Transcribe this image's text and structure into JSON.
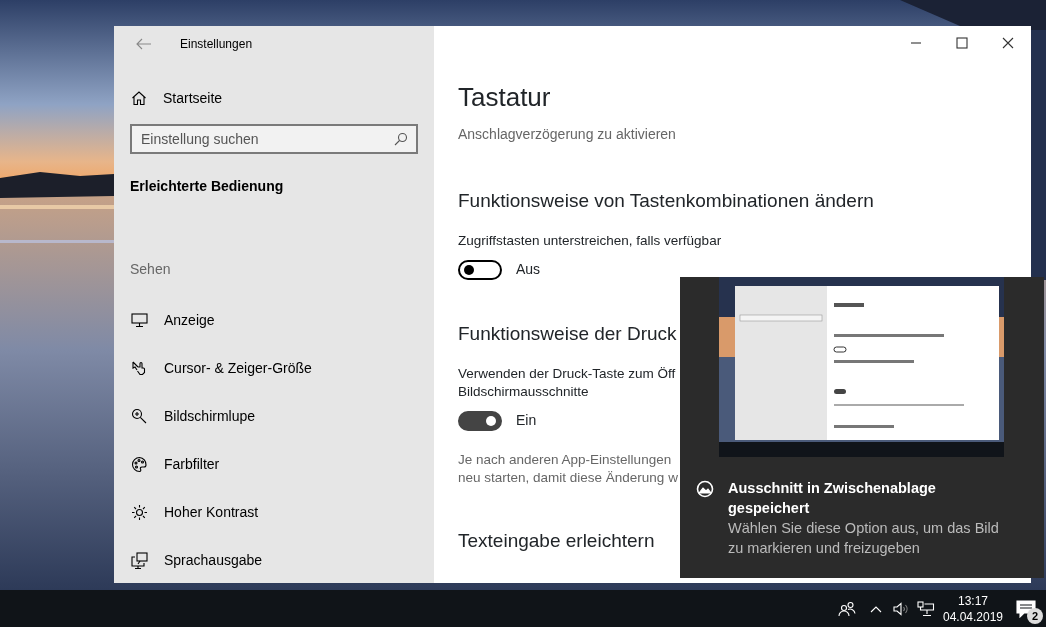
{
  "window": {
    "title": "Einstellungen"
  },
  "sidebar": {
    "home": "Startseite",
    "search": {
      "placeholder": "Einstellung suchen"
    },
    "category": "Erleichterte Bedienung",
    "section": "Sehen",
    "items": [
      {
        "label": "Anzeige"
      },
      {
        "label": "Cursor- & Zeiger-Größe"
      },
      {
        "label": "Bildschirmlupe"
      },
      {
        "label": "Farbfilter"
      },
      {
        "label": "Hoher Kontrast"
      },
      {
        "label": "Sprachausgabe"
      }
    ]
  },
  "main": {
    "title": "Tastatur",
    "partial_text": "Anschlagverzögerung zu aktivieren",
    "sections": [
      {
        "heading": "Funktionsweise von Tastenkombinationen ändern",
        "settings": [
          {
            "label": "Zugriffstasten unterstreichen, falls verfügbar",
            "on": false,
            "state_text": "Aus"
          }
        ]
      },
      {
        "heading": "Funktionsweise der Druck",
        "settings": [
          {
            "label": "Verwenden der Druck-Taste zum Öff",
            "label_line_2": "Bildschirmausschnitte",
            "on": true,
            "state_text": "Ein"
          }
        ],
        "note": "Je nach anderen App-Einstellungen",
        "note_line_2": "neu starten, damit diese Änderung w"
      },
      {
        "heading": "Texteingabe erleichtern"
      }
    ]
  },
  "notification": {
    "title": "Ausschnitt in Zwischenablage gespeichert",
    "body": "Wählen Sie diese Option aus, um das Bild zu markieren und freizugeben"
  },
  "taskbar": {
    "time": "13:17",
    "date": "04.04.2019",
    "notification_count": "2"
  }
}
